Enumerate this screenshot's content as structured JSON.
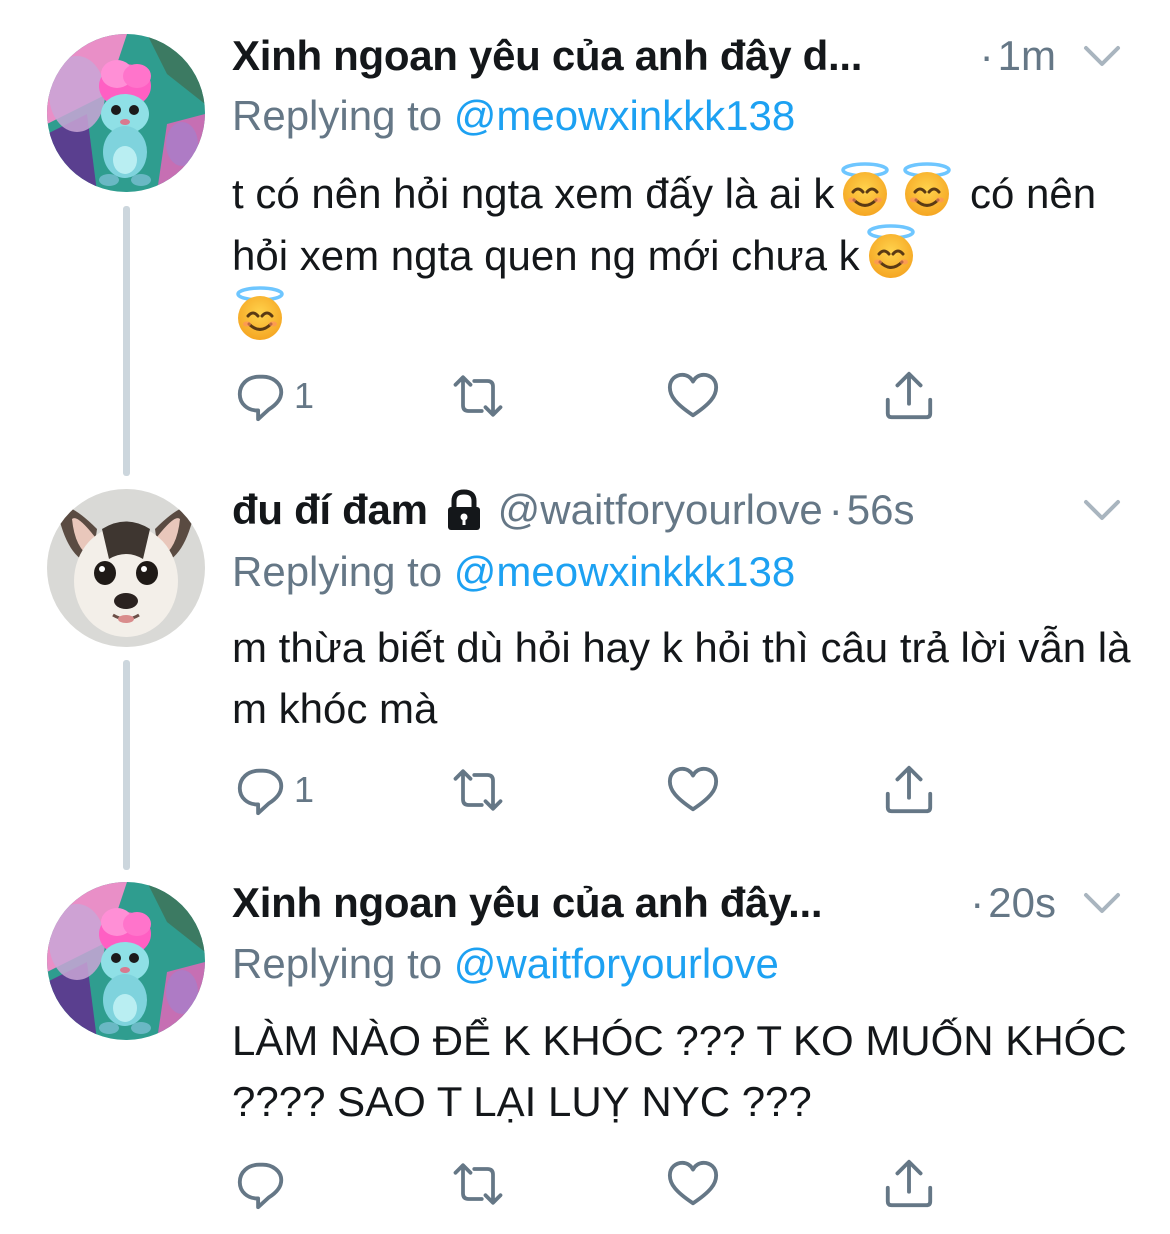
{
  "tweets": [
    {
      "name": "Xinh ngoan yêu của anh đây d...",
      "handle": "",
      "time": "1m",
      "replying_prefix": "Replying to ",
      "replying_to": "@meowxinkkk138",
      "body_parts": [
        "t có nên hỏi ngta xem đấy là ai k",
        " có nên hỏi xem ngta quen ng mới chưa k"
      ],
      "emoji": "smiling-face-with-halo",
      "reply_count": "1",
      "avatar": "pink-haired-cartoon-creature"
    },
    {
      "name": "đu đí đam",
      "handle": "@waitforyourlove",
      "time": "56s",
      "replying_prefix": "Replying to ",
      "replying_to": "@meowxinkkk138",
      "body": "m thừa biết dù hỏi hay k hỏi thì câu trả lời vẫn là m khóc mà",
      "reply_count": "1",
      "avatar": "chihuahua-dog-photo"
    },
    {
      "name": "Xinh ngoan yêu của anh đây...",
      "handle": "",
      "time": "20s",
      "replying_prefix": "Replying to ",
      "replying_to": "@waitforyourlove",
      "body": "LÀM NÀO ĐỂ K KHÓC ??? T KO MUỐN KHÓC ???? SAO T LẠI LUỴ NYC ???",
      "reply_count": "",
      "avatar": "pink-haired-cartoon-creature"
    }
  ],
  "dot_separator": "·",
  "icons": {
    "reply": "reply-icon",
    "retweet": "retweet-icon",
    "like": "heart-icon",
    "share": "share-icon",
    "more": "chevron-down-icon",
    "protected": "lock-icon"
  },
  "colors": {
    "text": "#14171a",
    "secondary": "#657786",
    "link": "#1da1f2",
    "thread_line": "#ccd6dd"
  }
}
